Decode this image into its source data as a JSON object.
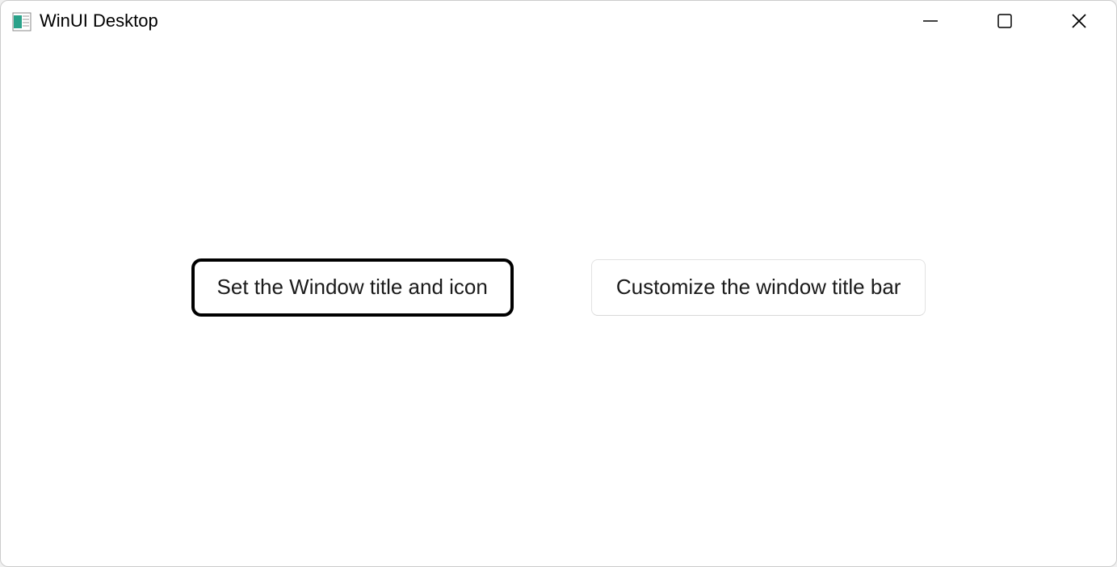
{
  "window": {
    "title": "WinUI Desktop"
  },
  "buttons": {
    "set_title_icon": "Set the Window title and icon",
    "customize_titlebar": "Customize the window title bar"
  }
}
